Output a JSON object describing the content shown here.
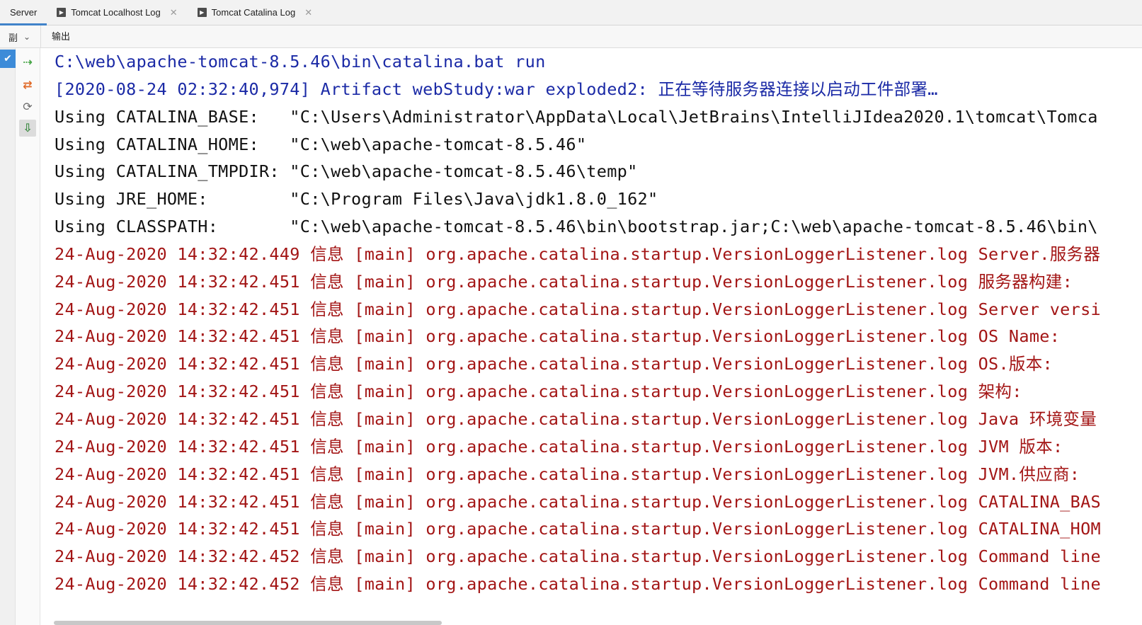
{
  "tabs": [
    {
      "label": "Server",
      "active": true,
      "icon": null
    },
    {
      "label": "Tomcat Localhost Log",
      "active": false,
      "icon": "console-play-icon"
    },
    {
      "label": "Tomcat Catalina Log",
      "active": false,
      "icon": "console-play-icon"
    }
  ],
  "subheader": {
    "left_label": "副",
    "output_label": "输出"
  },
  "toolbar": {
    "icons": [
      "deploy-icon",
      "undeploy-icon",
      "refresh-icon",
      "update-icon"
    ]
  },
  "console": {
    "lines": [
      {
        "text": "C:\\web\\apache-tomcat-8.5.46\\bin\\catalina.bat run",
        "color": "blue"
      },
      {
        "text": "[2020-08-24 02:32:40,974] Artifact webStudy:war exploded2: 正在等待服务器连接以启动工件部署…",
        "color": "blue"
      },
      {
        "text": "Using CATALINA_BASE:   \"C:\\Users\\Administrator\\AppData\\Local\\JetBrains\\IntelliJIdea2020.1\\tomcat\\Tomca",
        "color": "black"
      },
      {
        "text": "Using CATALINA_HOME:   \"C:\\web\\apache-tomcat-8.5.46\"",
        "color": "black"
      },
      {
        "text": "Using CATALINA_TMPDIR: \"C:\\web\\apache-tomcat-8.5.46\\temp\"",
        "color": "black"
      },
      {
        "text": "Using JRE_HOME:        \"C:\\Program Files\\Java\\jdk1.8.0_162\"",
        "color": "black"
      },
      {
        "text": "Using CLASSPATH:       \"C:\\web\\apache-tomcat-8.5.46\\bin\\bootstrap.jar;C:\\web\\apache-tomcat-8.5.46\\bin\\",
        "color": "black"
      },
      {
        "text": "24-Aug-2020 14:32:42.449 信息 [main] org.apache.catalina.startup.VersionLoggerListener.log Server.服务器",
        "color": "red"
      },
      {
        "text": "24-Aug-2020 14:32:42.451 信息 [main] org.apache.catalina.startup.VersionLoggerListener.log 服务器构建:",
        "color": "red"
      },
      {
        "text": "24-Aug-2020 14:32:42.451 信息 [main] org.apache.catalina.startup.VersionLoggerListener.log Server versi",
        "color": "red"
      },
      {
        "text": "24-Aug-2020 14:32:42.451 信息 [main] org.apache.catalina.startup.VersionLoggerListener.log OS Name:",
        "color": "red"
      },
      {
        "text": "24-Aug-2020 14:32:42.451 信息 [main] org.apache.catalina.startup.VersionLoggerListener.log OS.版本:",
        "color": "red"
      },
      {
        "text": "24-Aug-2020 14:32:42.451 信息 [main] org.apache.catalina.startup.VersionLoggerListener.log 架构:",
        "color": "red"
      },
      {
        "text": "24-Aug-2020 14:32:42.451 信息 [main] org.apache.catalina.startup.VersionLoggerListener.log Java 环境变量",
        "color": "red"
      },
      {
        "text": "24-Aug-2020 14:32:42.451 信息 [main] org.apache.catalina.startup.VersionLoggerListener.log JVM 版本:",
        "color": "red"
      },
      {
        "text": "24-Aug-2020 14:32:42.451 信息 [main] org.apache.catalina.startup.VersionLoggerListener.log JVM.供应商:",
        "color": "red"
      },
      {
        "text": "24-Aug-2020 14:32:42.451 信息 [main] org.apache.catalina.startup.VersionLoggerListener.log CATALINA_BAS",
        "color": "red"
      },
      {
        "text": "24-Aug-2020 14:32:42.451 信息 [main] org.apache.catalina.startup.VersionLoggerListener.log CATALINA_HOM",
        "color": "red"
      },
      {
        "text": "24-Aug-2020 14:32:42.452 信息 [main] org.apache.catalina.startup.VersionLoggerListener.log Command line",
        "color": "red"
      },
      {
        "text": "24-Aug-2020 14:32:42.452 信息 [main] org.apache.catalina.startup.VersionLoggerListener.log Command line",
        "color": "red"
      }
    ]
  },
  "colors": {
    "blue_text": "#1b2aa6",
    "red_text": "#a31515",
    "black_text": "#111111",
    "active_tab_underline": "#4083c9",
    "status_check": "#3d8bd8"
  }
}
